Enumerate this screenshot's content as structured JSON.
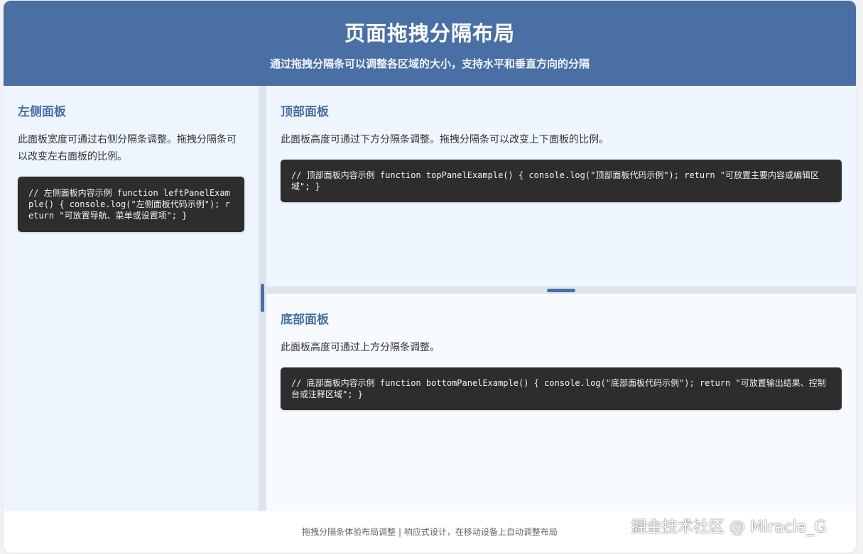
{
  "header": {
    "title": "页面拖拽分隔布局",
    "subtitle": "通过拖拽分隔条可以调整各区域的大小，支持水平和垂直方向的分隔"
  },
  "left_panel": {
    "title": "左侧面板",
    "description": "此面板宽度可通过右侧分隔条调整。拖拽分隔条可以改变左右面板的比例。",
    "code": "// 左侧面板内容示例 function leftPanelExample() { console.log(\"左侧面板代码示例\"); return \"可放置导航、菜单或设置项\"; }"
  },
  "top_panel": {
    "title": "顶部面板",
    "description": "此面板高度可通过下方分隔条调整。拖拽分隔条可以改变上下面板的比例。",
    "code": "// 顶部面板内容示例 function topPanelExample() { console.log(\"顶部面板代码示例\"); return \"可放置主要内容或编辑区域\"; }"
  },
  "bottom_panel": {
    "title": "底部面板",
    "description": "此面板高度可通过上方分隔条调整。",
    "code": "// 底部面板内容示例 function bottomPanelExample() { console.log(\"底部面板代码示例\"); return \"可放置输出结果、控制台或注释区域\"; }"
  },
  "footer": {
    "text": "拖拽分隔条体验布局调整 | 响应式设计，在移动设备上自动调整布局"
  },
  "watermark": {
    "text": "掘金技术社区 @ Miracle_G"
  },
  "colors": {
    "accent": "#4a6fa5",
    "code_bg": "#2d2d2d",
    "splitter": "#dde4ee"
  }
}
